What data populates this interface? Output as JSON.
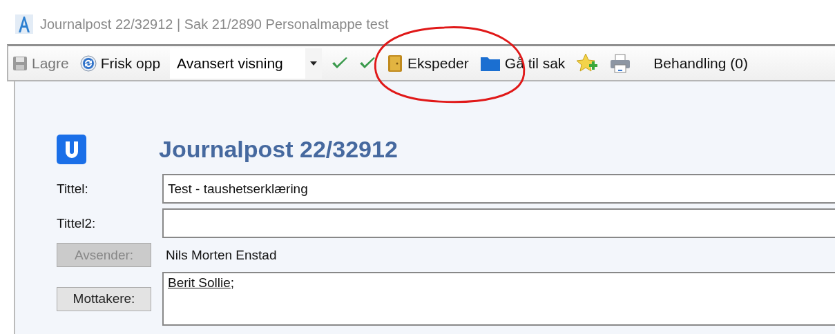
{
  "window": {
    "title": "Journalpost 22/32912 | Sak 21/2890 Personalmappe test"
  },
  "toolbar": [
    {
      "kind": "button",
      "label": "Lagre",
      "disabled": true
    },
    {
      "kind": "button",
      "label": "Frisk opp",
      "disabled": false
    },
    {
      "kind": "dropdown",
      "value": "Avansert visning"
    },
    {
      "kind": "icon"
    },
    {
      "kind": "icon"
    },
    {
      "kind": "button",
      "label": "Ekspeder",
      "disabled": false
    },
    {
      "kind": "button",
      "label": "Gå til sak",
      "disabled": false
    },
    {
      "kind": "icon"
    },
    {
      "kind": "icon"
    },
    {
      "kind": "button",
      "label": "Behandling (0)",
      "disabled": false
    }
  ],
  "form": {
    "heading": "Journalpost 22/32912",
    "fields": [
      {
        "kind": "input",
        "label": "Tittel:",
        "value": "Test - taushetserklæring"
      },
      {
        "kind": "input",
        "label": "Tittel2:"
      },
      {
        "kind": "button-text",
        "label": "Avsender:",
        "disabled": true,
        "value": "Nils Morten Enstad"
      },
      {
        "kind": "button-list",
        "label": "Mottakere:",
        "disabled": false,
        "items": [
          {
            "name": "Berit Sollie",
            "separator": ";"
          }
        ]
      }
    ]
  }
}
